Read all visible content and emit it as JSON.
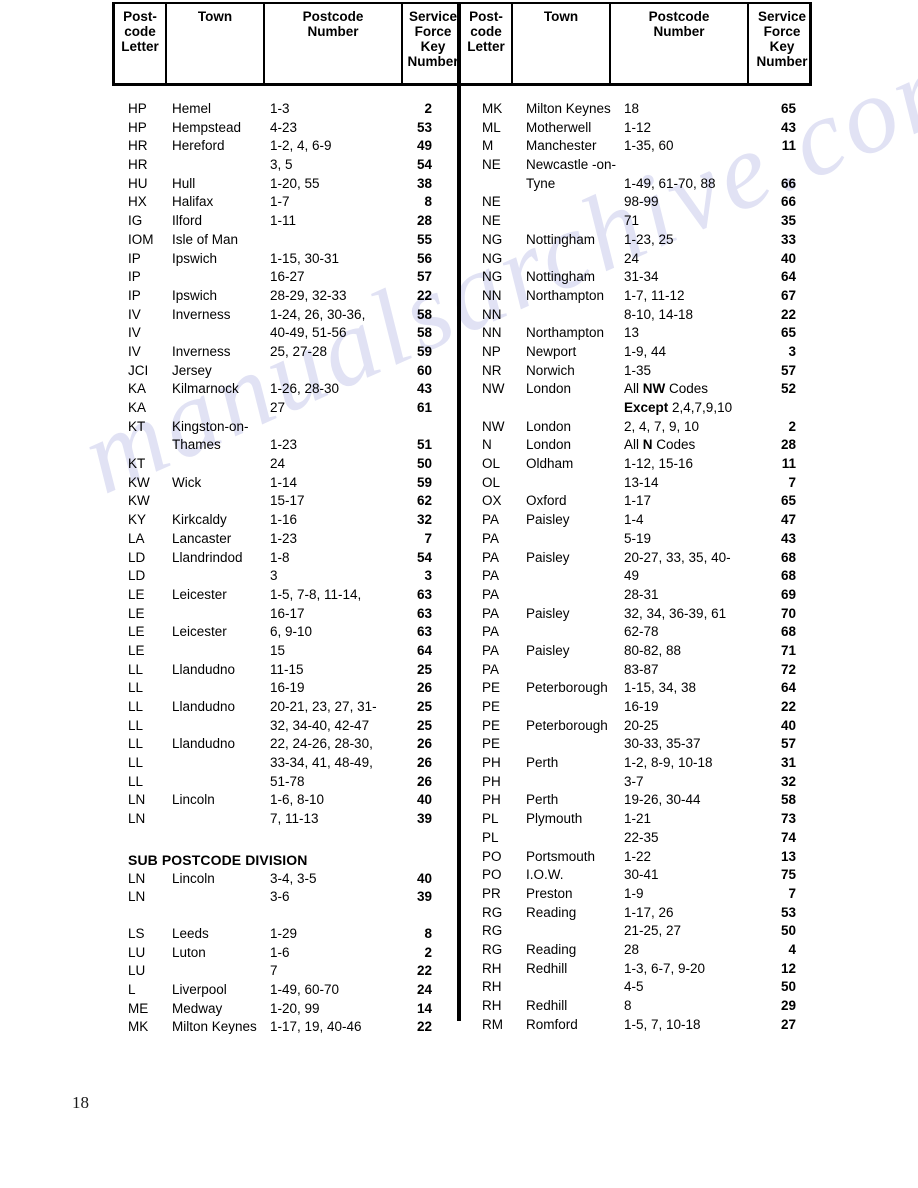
{
  "page": {
    "number": "18",
    "watermark": "manualsarchive.com"
  },
  "table": {
    "headers": {
      "postcode_letter": [
        "Post-",
        "code",
        "Letter"
      ],
      "town": [
        "Town"
      ],
      "postcode_number": [
        "Postcode",
        "Number"
      ],
      "service_force_key_number": [
        "Service",
        "Force",
        "Key",
        "Number"
      ]
    },
    "left_column": [
      {
        "letter": "HP",
        "town": "Hemel",
        "pcode": "1-3",
        "key": "2"
      },
      {
        "letter": "HP",
        "town": "Hempstead",
        "pcode": "4-23",
        "key": "53"
      },
      {
        "letter": "HR",
        "town": "Hereford",
        "pcode": "1-2, 4, 6-9",
        "key": "49"
      },
      {
        "letter": "HR",
        "town": "",
        "pcode": "3, 5",
        "key": "54"
      },
      {
        "letter": "HU",
        "town": "Hull",
        "pcode": "1-20, 55",
        "key": "38"
      },
      {
        "letter": "HX",
        "town": "Halifax",
        "pcode": "1-7",
        "key": "8"
      },
      {
        "letter": "IG",
        "town": "Ilford",
        "pcode": "1-11",
        "key": "28"
      },
      {
        "letter": "IOM",
        "town": "Isle of Man",
        "pcode": "",
        "key": "55"
      },
      {
        "letter": "IP",
        "town": "Ipswich",
        "pcode": "1-15, 30-31",
        "key": "56"
      },
      {
        "letter": "IP",
        "town": "",
        "pcode": "16-27",
        "key": "57"
      },
      {
        "letter": "IP",
        "town": "Ipswich",
        "pcode": "28-29, 32-33",
        "key": "22"
      },
      {
        "letter": "IV",
        "town": "Inverness",
        "pcode": "1-24, 26, 30-36,",
        "key": "58"
      },
      {
        "letter": "IV",
        "town": "",
        "pcode": "40-49, 51-56",
        "key": "58"
      },
      {
        "letter": "IV",
        "town": "Inverness",
        "pcode": "25, 27-28",
        "key": "59"
      },
      {
        "letter": "JCI",
        "town": "Jersey",
        "pcode": "",
        "key": "60"
      },
      {
        "letter": "KA",
        "town": "Kilmarnock",
        "pcode": "1-26, 28-30",
        "key": "43"
      },
      {
        "letter": "KA",
        "town": "",
        "pcode": "27",
        "key": "61"
      },
      {
        "letter": "KT",
        "town": "Kingston-on-",
        "pcode": "",
        "key": ""
      },
      {
        "letter": "",
        "town": "Thames",
        "pcode": "1-23",
        "key": "51"
      },
      {
        "letter": "KT",
        "town": "",
        "pcode": "24",
        "key": "50"
      },
      {
        "letter": "KW",
        "town": "Wick",
        "pcode": "1-14",
        "key": "59"
      },
      {
        "letter": "KW",
        "town": "",
        "pcode": "15-17",
        "key": "62"
      },
      {
        "letter": "KY",
        "town": "Kirkcaldy",
        "pcode": "1-16",
        "key": "32"
      },
      {
        "letter": "LA",
        "town": "Lancaster",
        "pcode": "1-23",
        "key": "7"
      },
      {
        "letter": "LD",
        "town": "Llandrindod",
        "pcode": "1-8",
        "key": "54"
      },
      {
        "letter": "LD",
        "town": "",
        "pcode": "3",
        "key": "3"
      },
      {
        "letter": "LE",
        "town": "Leicester",
        "pcode": "1-5, 7-8, 11-14,",
        "key": "63"
      },
      {
        "letter": "LE",
        "town": "",
        "pcode": "16-17",
        "key": "63"
      },
      {
        "letter": "LE",
        "town": "Leicester",
        "pcode": "6, 9-10",
        "key": "63"
      },
      {
        "letter": "LE",
        "town": "",
        "pcode": "15",
        "key": "64"
      },
      {
        "letter": "LL",
        "town": "Llandudno",
        "pcode": "11-15",
        "key": "25"
      },
      {
        "letter": "LL",
        "town": "",
        "pcode": "16-19",
        "key": "26"
      },
      {
        "letter": "LL",
        "town": "Llandudno",
        "pcode": "20-21, 23, 27, 31-",
        "key": "25"
      },
      {
        "letter": "LL",
        "town": "",
        "pcode": "32, 34-40, 42-47",
        "key": "25"
      },
      {
        "letter": "LL",
        "town": "Llandudno",
        "pcode": "22, 24-26, 28-30,",
        "key": "26"
      },
      {
        "letter": "LL",
        "town": "",
        "pcode": "33-34, 41, 48-49,",
        "key": "26"
      },
      {
        "letter": "LL",
        "town": "",
        "pcode": "51-78",
        "key": "26"
      },
      {
        "letter": "LN",
        "town": "Lincoln",
        "pcode": "1-6, 8-10",
        "key": "40"
      },
      {
        "letter": "LN",
        "town": "",
        "pcode": "7, 11-13",
        "key": "39"
      }
    ],
    "sub_division": {
      "heading": "SUB POSTCODE DIVISION",
      "rows": [
        {
          "letter": "LN",
          "town": "Lincoln",
          "pcode": "3-4, 3-5",
          "key": "40"
        },
        {
          "letter": "LN",
          "town": "",
          "pcode": "3-6",
          "key": "39"
        }
      ]
    },
    "left_column_tail": [
      {
        "letter": "LS",
        "town": "Leeds",
        "pcode": "1-29",
        "key": "8"
      },
      {
        "letter": "LU",
        "town": "Luton",
        "pcode": "1-6",
        "key": "2"
      },
      {
        "letter": "LU",
        "town": "",
        "pcode": "7",
        "key": "22"
      },
      {
        "letter": "L",
        "town": "Liverpool",
        "pcode": "1-49, 60-70",
        "key": "24"
      },
      {
        "letter": "ME",
        "town": "Medway",
        "pcode": "1-20, 99",
        "key": "14"
      },
      {
        "letter": "MK",
        "town": "Milton Keynes",
        "pcode": "1-17, 19, 40-46",
        "key": "22"
      }
    ],
    "right_column": [
      {
        "letter": "MK",
        "town": "Milton Keynes",
        "pcode": "18",
        "key": "65"
      },
      {
        "letter": "ML",
        "town": "Motherwell",
        "pcode": "1-12",
        "key": "43"
      },
      {
        "letter": "M",
        "town": "Manchester",
        "pcode": "1-35, 60",
        "key": "11"
      },
      {
        "letter": "NE",
        "town": "Newcastle -on-",
        "pcode": "",
        "key": ""
      },
      {
        "letter": "",
        "town": "Tyne",
        "pcode": "1-49, 61-70, 88",
        "key": "66"
      },
      {
        "letter": "NE",
        "town": "",
        "pcode": "98-99",
        "key": "66"
      },
      {
        "letter": "NE",
        "town": "",
        "pcode": "71",
        "key": "35"
      },
      {
        "letter": "NG",
        "town": "Nottingham",
        "pcode": "1-23, 25",
        "key": "33"
      },
      {
        "letter": "NG",
        "town": "",
        "pcode": "24",
        "key": "40"
      },
      {
        "letter": "NG",
        "town": "Nottingham",
        "pcode": "31-34",
        "key": "64"
      },
      {
        "letter": "NN",
        "town": "Northampton",
        "pcode": "1-7, 11-12",
        "key": "67"
      },
      {
        "letter": "NN",
        "town": "",
        "pcode": "8-10, 14-18",
        "key": "22"
      },
      {
        "letter": "NN",
        "town": "Northampton",
        "pcode": "13",
        "key": "65"
      },
      {
        "letter": "NP",
        "town": "Newport",
        "pcode": "1-9, 44",
        "key": "3"
      },
      {
        "letter": "NR",
        "town": "Norwich",
        "pcode": "1-35",
        "key": "57"
      },
      {
        "letter": "NW",
        "town": "London",
        "pcode_rich": [
          {
            "t": "All ",
            "b": false
          },
          {
            "t": "NW",
            "b": true
          },
          {
            "t": " Codes",
            "b": false
          }
        ],
        "pcode": "All NW Codes",
        "key": "52"
      },
      {
        "letter": "",
        "town": "",
        "pcode_rich": [
          {
            "t": "Except",
            "b": true
          },
          {
            "t": " 2,4,7,9,10",
            "b": false
          }
        ],
        "pcode": "Except 2,4,7,9,10",
        "key": ""
      },
      {
        "letter": "NW",
        "town": "London",
        "pcode": "2, 4, 7, 9, 10",
        "key": "2"
      },
      {
        "letter": "N",
        "town": "London",
        "pcode_rich": [
          {
            "t": "All ",
            "b": false
          },
          {
            "t": "N",
            "b": true
          },
          {
            "t": " Codes",
            "b": false
          }
        ],
        "pcode": "All N Codes",
        "key": "28"
      },
      {
        "letter": "OL",
        "town": "Oldham",
        "pcode": "1-12, 15-16",
        "key": "11"
      },
      {
        "letter": "OL",
        "town": "",
        "pcode": "13-14",
        "key": "7"
      },
      {
        "letter": "OX",
        "town": "Oxford",
        "pcode": "1-17",
        "key": "65"
      },
      {
        "letter": "PA",
        "town": "Paisley",
        "pcode": "1-4",
        "key": "47"
      },
      {
        "letter": "PA",
        "town": "",
        "pcode": "5-19",
        "key": "43"
      },
      {
        "letter": "PA",
        "town": "Paisley",
        "pcode": "20-27, 33, 35, 40-",
        "key": "68"
      },
      {
        "letter": "PA",
        "town": "",
        "pcode": "49",
        "key": "68"
      },
      {
        "letter": "PA",
        "town": "",
        "pcode": "28-31",
        "key": "69"
      },
      {
        "letter": "PA",
        "town": "Paisley",
        "pcode": "32, 34, 36-39, 61",
        "key": "70"
      },
      {
        "letter": "PA",
        "town": "",
        "pcode": "62-78",
        "key": "68"
      },
      {
        "letter": "PA",
        "town": "Paisley",
        "pcode": "80-82, 88",
        "key": "71"
      },
      {
        "letter": "PA",
        "town": "",
        "pcode": "83-87",
        "key": "72"
      },
      {
        "letter": "PE",
        "town": "Peterborough",
        "pcode": "1-15, 34, 38",
        "key": "64"
      },
      {
        "letter": "PE",
        "town": "",
        "pcode": "16-19",
        "key": "22"
      },
      {
        "letter": "PE",
        "town": "Peterborough",
        "pcode": "20-25",
        "key": "40"
      },
      {
        "letter": "PE",
        "town": "",
        "pcode": "30-33, 35-37",
        "key": "57"
      },
      {
        "letter": "PH",
        "town": "Perth",
        "pcode": "1-2, 8-9, 10-18",
        "key": "31"
      },
      {
        "letter": "PH",
        "town": "",
        "pcode": "3-7",
        "key": "32"
      },
      {
        "letter": "PH",
        "town": "Perth",
        "pcode": "19-26, 30-44",
        "key": "58"
      },
      {
        "letter": "PL",
        "town": "Plymouth",
        "pcode": "1-21",
        "key": "73"
      },
      {
        "letter": "PL",
        "town": "",
        "pcode": "22-35",
        "key": "74"
      },
      {
        "letter": "PO",
        "town": "Portsmouth",
        "pcode": "1-22",
        "key": "13"
      },
      {
        "letter": "PO",
        "town": "I.O.W.",
        "pcode": "30-41",
        "key": "75"
      },
      {
        "letter": "PR",
        "town": "Preston",
        "pcode": "1-9",
        "key": "7"
      },
      {
        "letter": "RG",
        "town": "Reading",
        "pcode": "1-17, 26",
        "key": "53"
      },
      {
        "letter": "RG",
        "town": "",
        "pcode": "21-25, 27",
        "key": "50"
      },
      {
        "letter": "RG",
        "town": "Reading",
        "pcode": "28",
        "key": "4"
      },
      {
        "letter": "RH",
        "town": "Redhill",
        "pcode": "1-3, 6-7, 9-20",
        "key": "12"
      },
      {
        "letter": "RH",
        "town": "",
        "pcode": "4-5",
        "key": "50"
      },
      {
        "letter": "RH",
        "town": "Redhill",
        "pcode": "8",
        "key": "29"
      },
      {
        "letter": "RM",
        "town": "Romford",
        "pcode": "1-5, 7, 10-18",
        "key": "27"
      }
    ]
  }
}
